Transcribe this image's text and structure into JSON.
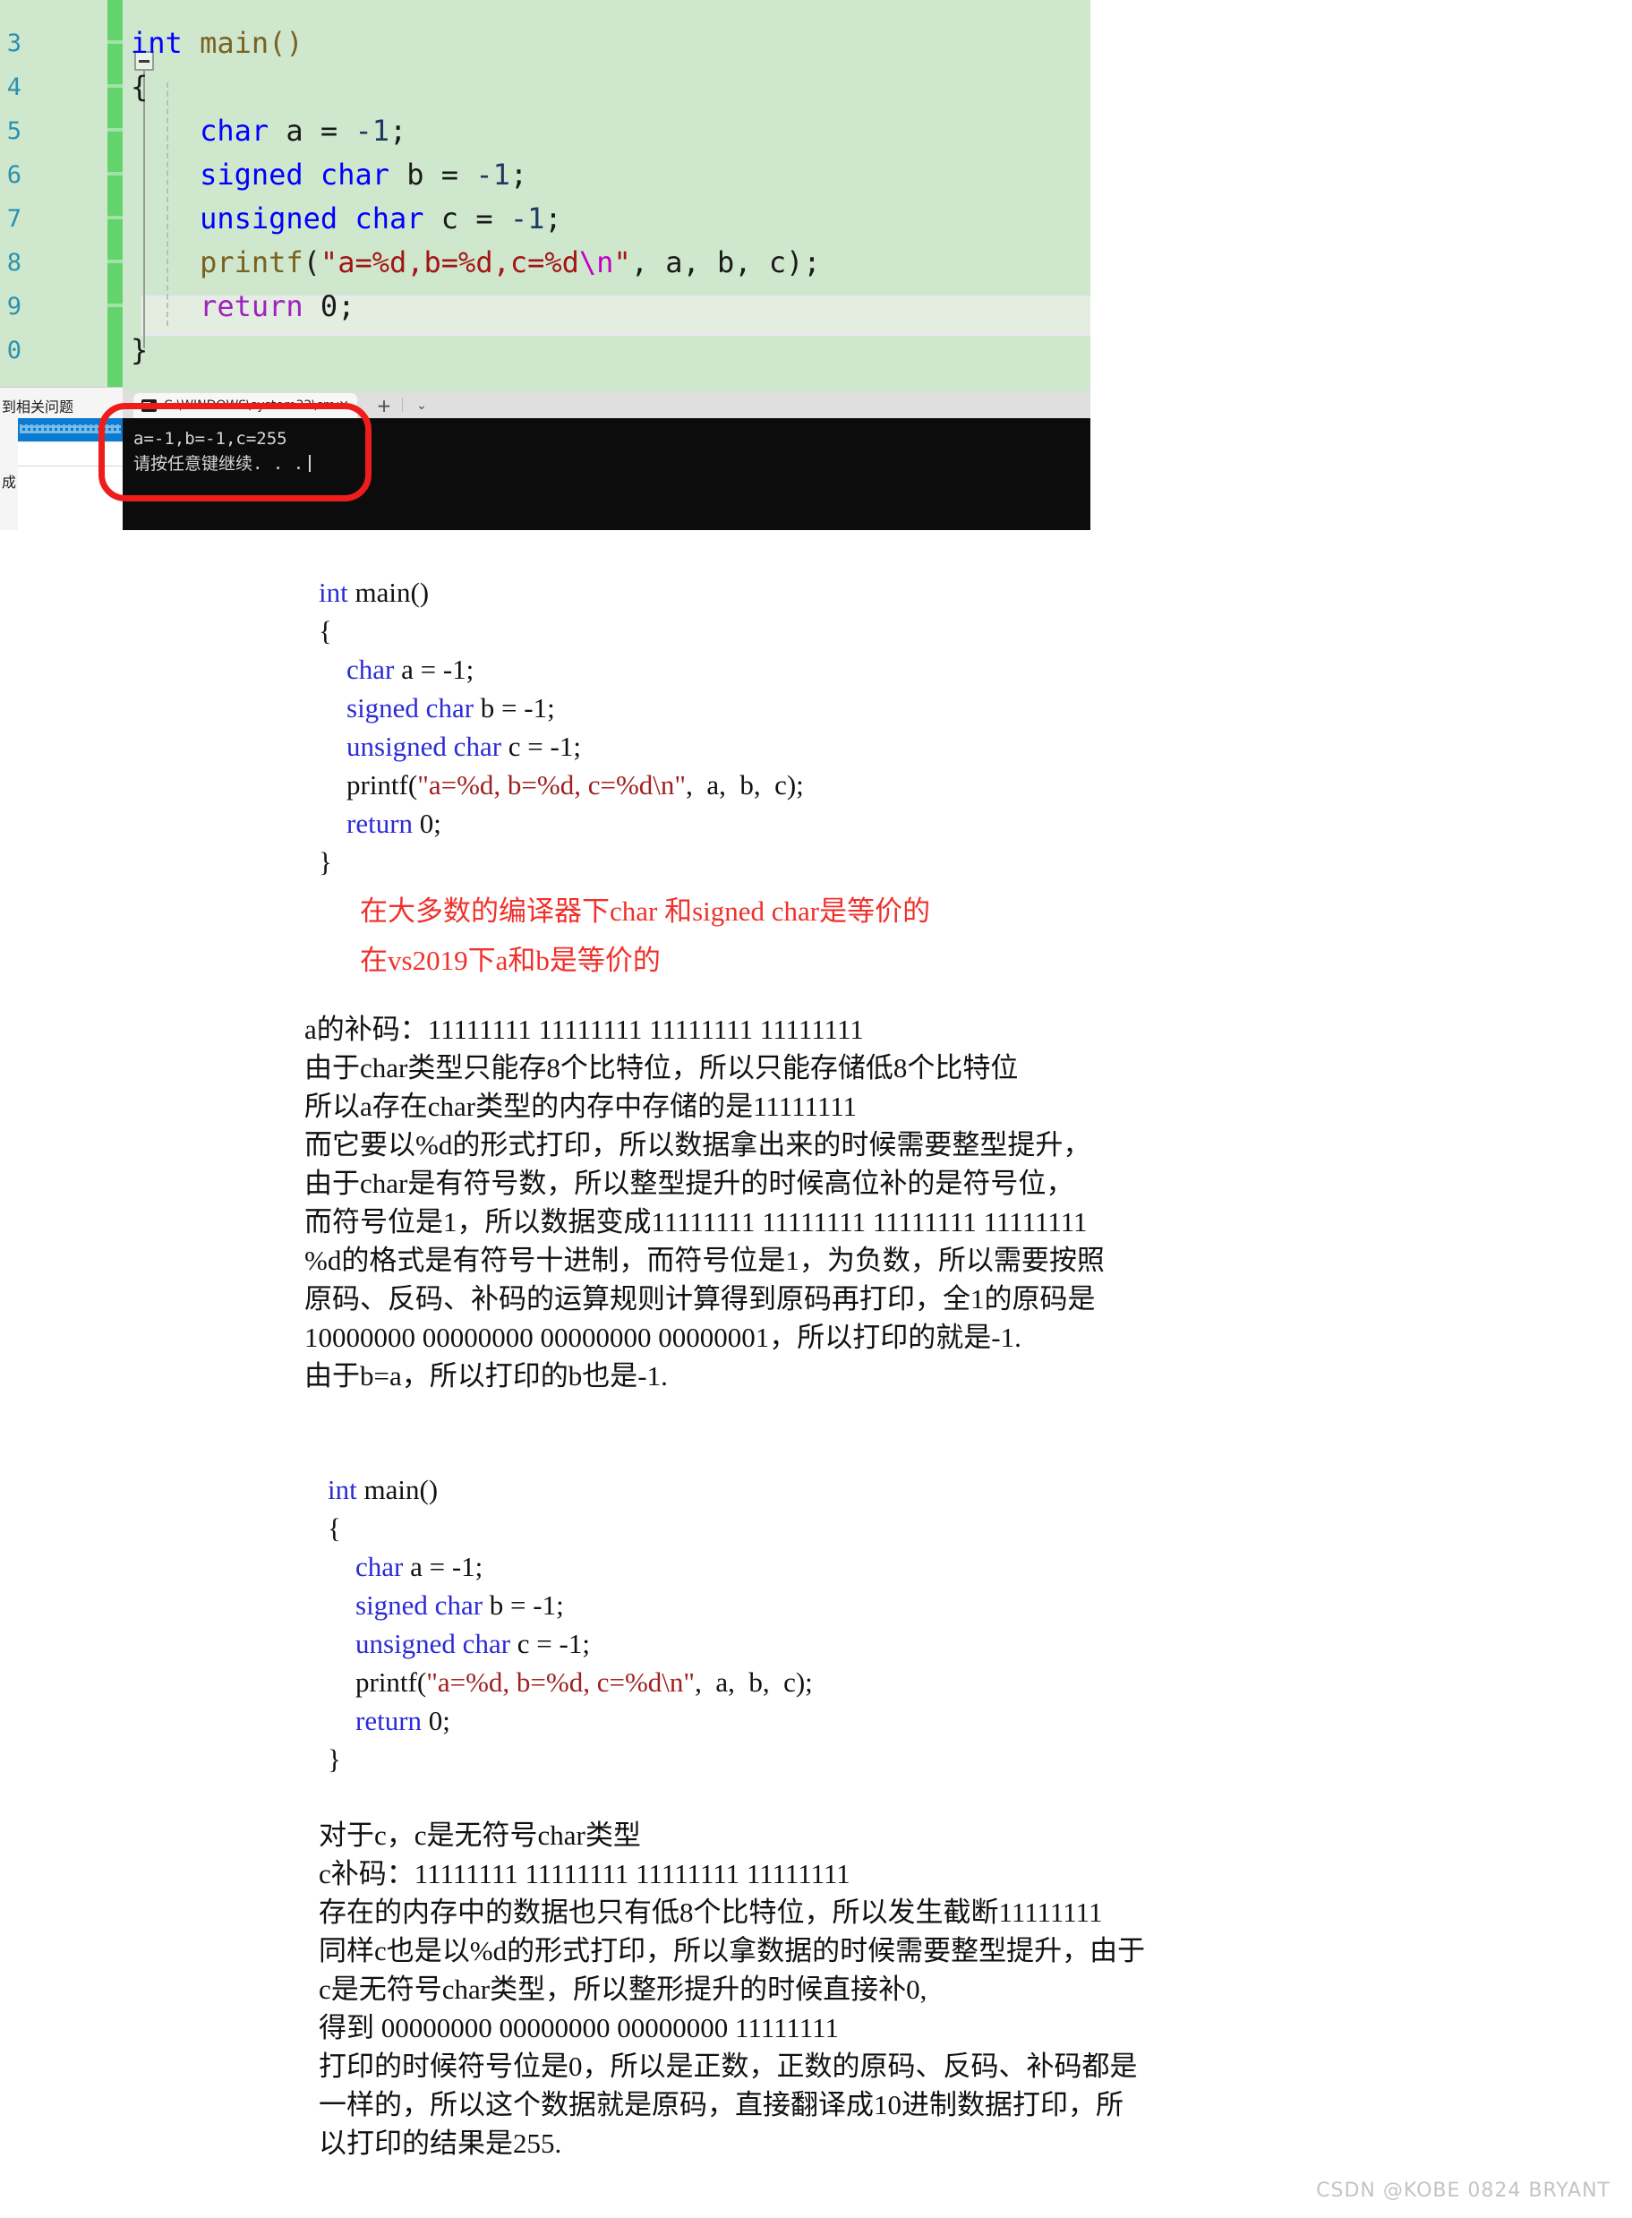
{
  "vs_editor": {
    "line_numbers": [
      "3",
      "4",
      "5",
      "6",
      "7",
      "8",
      "9",
      "0"
    ],
    "code_lines": [
      [
        {
          "t": "int",
          "c": "kw"
        },
        {
          "t": " main()",
          "c": "fn"
        }
      ],
      [
        {
          "t": "{",
          "c": "pl"
        }
      ],
      [
        {
          "t": "    ",
          "c": "pl"
        },
        {
          "t": "char",
          "c": "kw"
        },
        {
          "t": " a = ",
          "c": "pl"
        },
        {
          "t": "-1",
          "c": "var"
        },
        {
          "t": ";",
          "c": "pl"
        }
      ],
      [
        {
          "t": "    ",
          "c": "pl"
        },
        {
          "t": "signed char",
          "c": "kw"
        },
        {
          "t": " b = ",
          "c": "pl"
        },
        {
          "t": "-1",
          "c": "var"
        },
        {
          "t": ";",
          "c": "pl"
        }
      ],
      [
        {
          "t": "    ",
          "c": "pl"
        },
        {
          "t": "unsigned char",
          "c": "kw"
        },
        {
          "t": " c = ",
          "c": "pl"
        },
        {
          "t": "-1",
          "c": "var"
        },
        {
          "t": ";",
          "c": "pl"
        }
      ],
      [
        {
          "t": "    ",
          "c": "pl"
        },
        {
          "t": "printf",
          "c": "fn"
        },
        {
          "t": "(",
          "c": "pl"
        },
        {
          "t": "\"a=%d,b=%d,c=%d",
          "c": "str"
        },
        {
          "t": "\\n",
          "c": "esc"
        },
        {
          "t": "\"",
          "c": "str"
        },
        {
          "t": ", a, b, c);",
          "c": "pl"
        }
      ],
      [
        {
          "t": "    ",
          "c": "pl"
        },
        {
          "t": "return",
          "c": "kwp"
        },
        {
          "t": " 0;",
          "c": "pl"
        }
      ],
      [
        {
          "t": "}",
          "c": "pl"
        }
      ]
    ],
    "panel": {
      "label_top": "到相关问题",
      "label_bottom": "成"
    }
  },
  "terminal": {
    "tab_title": "C:\\WINDOWS\\system32\\cmd.",
    "tab_close": "✕",
    "new_tab": "+",
    "dropdown": "⌄",
    "output_lines": [
      "a=-1,b=-1,c=255",
      "请按任意键继续. . ."
    ]
  },
  "document": {
    "code_block_1": [
      [
        {
          "t": "int",
          "c": "ckw"
        },
        {
          "t": " main()",
          "c": ""
        }
      ],
      [
        {
          "t": "{",
          "c": ""
        }
      ],
      [
        {
          "t": "    ",
          "c": ""
        },
        {
          "t": "char",
          "c": "ckw"
        },
        {
          "t": " a = -1;",
          "c": ""
        }
      ],
      [
        {
          "t": "    ",
          "c": ""
        },
        {
          "t": "signed char",
          "c": "ckw"
        },
        {
          "t": " b = -1;",
          "c": ""
        }
      ],
      [
        {
          "t": "    ",
          "c": ""
        },
        {
          "t": "unsigned char",
          "c": "ckw"
        },
        {
          "t": " c = -1;",
          "c": ""
        }
      ],
      [
        {
          "t": "    printf(",
          "c": ""
        },
        {
          "t": "\"a=%d, b=%d, c=%d\\n\"",
          "c": "cstr"
        },
        {
          "t": ",  a,  b,  c);",
          "c": ""
        }
      ],
      [
        {
          "t": "    ",
          "c": ""
        },
        {
          "t": "return",
          "c": "ckw"
        },
        {
          "t": " 0;",
          "c": ""
        }
      ],
      [
        {
          "t": "}",
          "c": ""
        }
      ]
    ],
    "red_note": [
      "在大多数的编译器下char 和signed char是等价的",
      "在vs2019下a和b是等价的"
    ],
    "paragraph_1": [
      "a的补码：11111111 11111111 11111111 11111111",
      "由于char类型只能存8个比特位，所以只能存储低8个比特位",
      "所以a存在char类型的内存中存储的是11111111",
      "而它要以%d的形式打印，所以数据拿出来的时候需要整型提升，",
      "由于char是有符号数，所以整型提升的时候高位补的是符号位，",
      "而符号位是1，所以数据变成11111111 11111111 11111111 11111111",
      "%d的格式是有符号十进制，而符号位是1，为负数，所以需要按照",
      "原码、反码、补码的运算规则计算得到原码再打印，全1的原码是",
      "10000000 00000000 00000000 00000001，所以打印的就是-1.",
      "由于b=a，所以打印的b也是-1."
    ],
    "code_block_2": [
      [
        {
          "t": "int",
          "c": "ckw"
        },
        {
          "t": " main()",
          "c": ""
        }
      ],
      [
        {
          "t": "{",
          "c": ""
        }
      ],
      [
        {
          "t": "    ",
          "c": ""
        },
        {
          "t": "char",
          "c": "ckw"
        },
        {
          "t": " a = -1;",
          "c": ""
        }
      ],
      [
        {
          "t": "    ",
          "c": ""
        },
        {
          "t": "signed char",
          "c": "ckw"
        },
        {
          "t": " b = -1;",
          "c": ""
        }
      ],
      [
        {
          "t": "    ",
          "c": ""
        },
        {
          "t": "unsigned char",
          "c": "ckw"
        },
        {
          "t": " c = -1;",
          "c": ""
        }
      ],
      [
        {
          "t": "    printf(",
          "c": ""
        },
        {
          "t": "\"a=%d, b=%d, c=%d\\n\"",
          "c": "cstr"
        },
        {
          "t": ",  a,  b,  c);",
          "c": ""
        }
      ],
      [
        {
          "t": "    ",
          "c": ""
        },
        {
          "t": "return",
          "c": "ckw"
        },
        {
          "t": " 0;",
          "c": ""
        }
      ],
      [
        {
          "t": "}",
          "c": ""
        }
      ]
    ],
    "paragraph_2": [
      "对于c，c是无符号char类型",
      "c补码：11111111 11111111 11111111 11111111",
      "存在的内存中的数据也只有低8个比特位，所以发生截断11111111",
      "同样c也是以%d的形式打印，所以拿数据的时候需要整型提升，由于",
      "c是无符号char类型，所以整形提升的时候直接补0,",
      "得到 00000000 00000000 00000000 11111111",
      "打印的时候符号位是0，所以是正数，正数的原码、反码、补码都是",
      "一样的，所以这个数据就是原码，直接翻译成10进制数据打印，所",
      "以打印的结果是255."
    ]
  },
  "watermark": "CSDN @KOBE 0824 BRYANT",
  "colors": {
    "vs_background": "#cfe7cd",
    "vs_keyword": "#0000ff",
    "vs_string": "#a31515",
    "vs_escape": "#c400c4",
    "vs_function": "#7a6220",
    "change_bar": "#63d46b",
    "terminal_background": "#0c0c0c",
    "annotation_red": "#ef1c1c",
    "doc_red": "#f0302a",
    "doc_code_keyword": "#2b2bd6",
    "doc_code_string": "#a02020"
  }
}
